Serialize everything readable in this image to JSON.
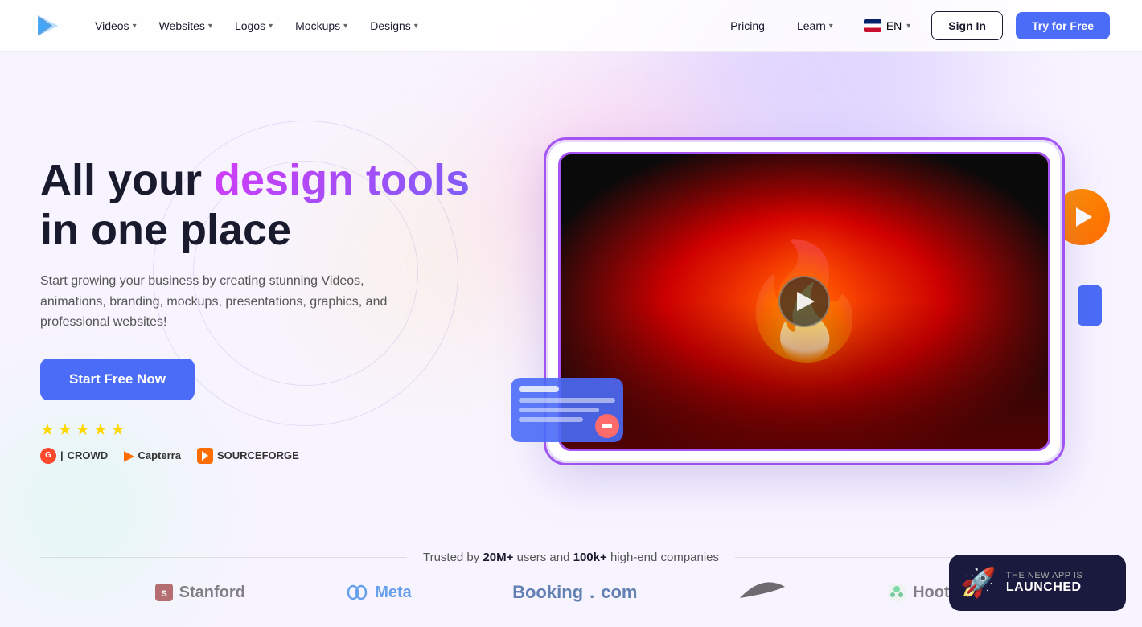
{
  "nav": {
    "logo_alt": "Renderforest logo",
    "items": [
      {
        "label": "Videos",
        "has_dropdown": true
      },
      {
        "label": "Websites",
        "has_dropdown": true
      },
      {
        "label": "Logos",
        "has_dropdown": true
      },
      {
        "label": "Mockups",
        "has_dropdown": true
      },
      {
        "label": "Designs",
        "has_dropdown": true
      }
    ],
    "right_items": [
      {
        "label": "Pricing"
      },
      {
        "label": "Learn",
        "has_dropdown": true
      }
    ],
    "lang": "EN",
    "signin_label": "Sign In",
    "try_label": "Try for Free"
  },
  "hero": {
    "title_prefix": "All your ",
    "title_accent": "design tools",
    "title_suffix": "in one place",
    "subtitle": "Start growing your business by creating stunning Videos, animations, branding, mockups, presentations, graphics, and professional websites!",
    "cta_label": "Start Free Now",
    "stars": [
      "★",
      "★",
      "★",
      "★",
      "★"
    ],
    "review_logos": [
      {
        "name": "G2 Crowd",
        "badge": "G2",
        "text": "CROWD"
      },
      {
        "name": "Capterra",
        "badge": "▶",
        "text": "Capterra"
      },
      {
        "name": "SourceForge",
        "badge": "SF",
        "text": "SOURCEFORGE"
      }
    ]
  },
  "video": {
    "play_label": "Play video",
    "fire_visual": "🔥"
  },
  "trusted": {
    "prefix_text": "Trusted by ",
    "users_count": "20M+",
    "middle_text": " users and ",
    "companies_count": "100k+",
    "suffix_text": " high-end companies",
    "partners": [
      {
        "name": "Stanford",
        "logo_text": "🛡 Stanford"
      },
      {
        "name": "Meta",
        "logo_text": "∞ Meta"
      },
      {
        "name": "Booking.com",
        "logo_text": "Booking.com"
      },
      {
        "name": "Nike",
        "logo_text": "✓"
      },
      {
        "name": "Hootsuite",
        "logo_text": "🦉 Hootsuite"
      }
    ]
  },
  "app_banner": {
    "small_text": "THE NEW APP IS",
    "large_text": "LAUNCHED",
    "emoji": "🚀"
  }
}
